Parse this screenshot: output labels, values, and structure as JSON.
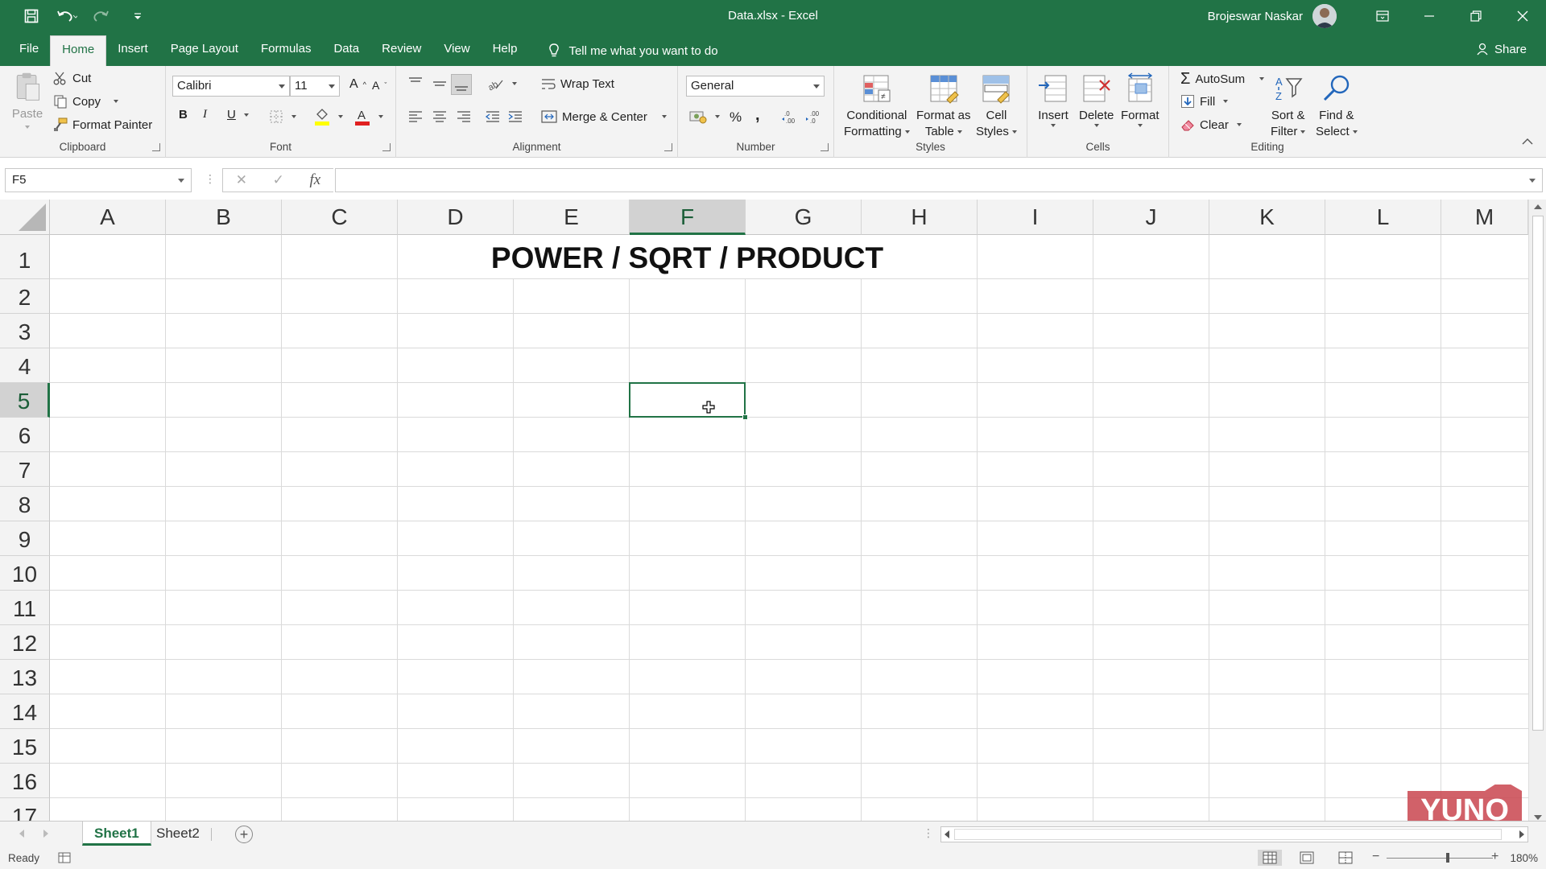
{
  "window": {
    "document_title": "Data.xlsx  -  Excel",
    "user_name": "Brojeswar Naskar"
  },
  "ribbon_tabs": [
    "File",
    "Home",
    "Insert",
    "Page Layout",
    "Formulas",
    "Data",
    "Review",
    "View",
    "Help"
  ],
  "active_tab": "Home",
  "tell_me": "Tell me what you want to do",
  "share_label": "Share",
  "clipboard": {
    "paste": "Paste",
    "cut": "Cut",
    "copy": "Copy",
    "format_painter": "Format Painter",
    "label": "Clipboard"
  },
  "font": {
    "name": "Calibri",
    "size": "11",
    "label": "Font",
    "bold": "B",
    "italic": "I",
    "underline": "U"
  },
  "alignment": {
    "wrap_text": "Wrap Text",
    "merge_center": "Merge & Center",
    "label": "Alignment"
  },
  "number": {
    "format": "General",
    "percent": "%",
    "comma": ",",
    "label": "Number"
  },
  "styles": {
    "conditional_1": "Conditional",
    "conditional_2": "Formatting",
    "format_table_1": "Format as",
    "format_table_2": "Table",
    "cell_styles_1": "Cell",
    "cell_styles_2": "Styles",
    "label": "Styles"
  },
  "cells": {
    "insert": "Insert",
    "delete": "Delete",
    "format": "Format",
    "label": "Cells"
  },
  "editing": {
    "autosum": "AutoSum",
    "fill": "Fill",
    "clear": "Clear",
    "sort_1": "Sort &",
    "sort_2": "Filter",
    "find_1": "Find &",
    "find_2": "Select",
    "label": "Editing"
  },
  "formula_bar": {
    "name_box": "F5",
    "fx": "fx",
    "formula": ""
  },
  "grid": {
    "columns": [
      "A",
      "B",
      "C",
      "D",
      "E",
      "F",
      "G",
      "H",
      "I",
      "J",
      "K",
      "L",
      "M"
    ],
    "rows": [
      "1",
      "2",
      "3",
      "4",
      "5",
      "6",
      "7",
      "8",
      "9",
      "10",
      "11",
      "12",
      "13",
      "14",
      "15",
      "16",
      "17"
    ],
    "selected_cell": "F5",
    "title_text": "POWER / SQRT / PRODUCT"
  },
  "sheets": [
    "Sheet1",
    "Sheet2"
  ],
  "active_sheet": "Sheet1",
  "status": {
    "ready": "Ready",
    "zoom": "180%"
  },
  "logo_text": "YUNO"
}
